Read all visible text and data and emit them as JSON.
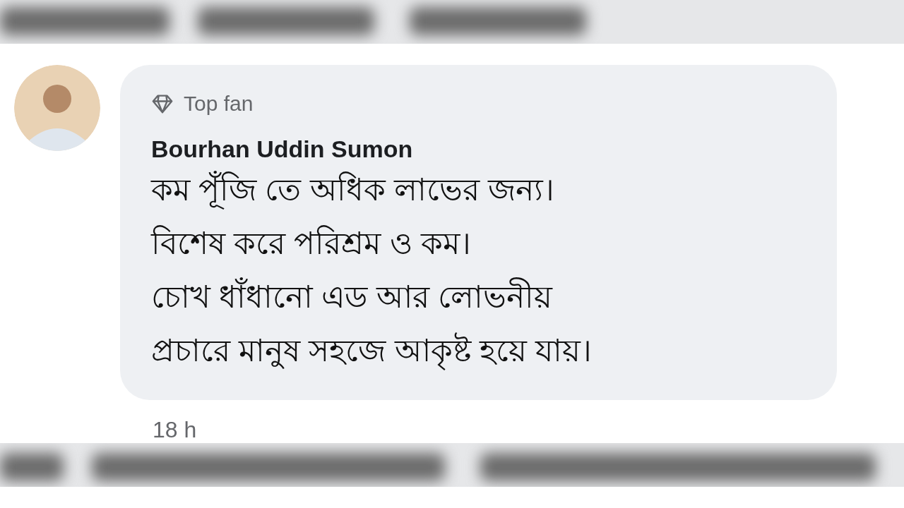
{
  "comment": {
    "badge": "Top fan",
    "author": "Bourhan Uddin Sumon",
    "lines": [
      "কম পূঁজি তে অধিক লাভের জন্য।",
      "বিশেষ করে পরিশ্রম ও কম।",
      "চোখ ধাঁধানো এড আর লোভনীয়",
      "প্রচারে মানুষ সহজে আকৃষ্ট হয়ে যায়।"
    ],
    "time": "18 h"
  }
}
